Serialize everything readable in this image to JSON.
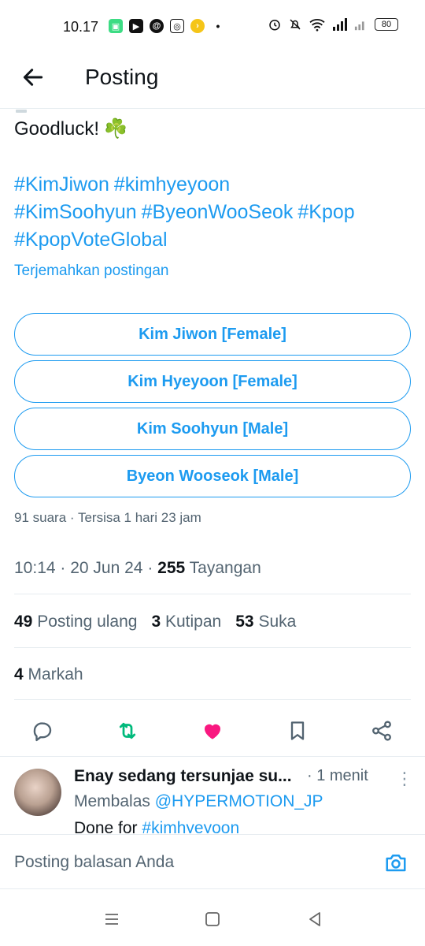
{
  "status_bar": {
    "time": "10.17",
    "battery": "80"
  },
  "header": {
    "title": "Posting"
  },
  "post": {
    "body": "Goodluck!",
    "body_emoji": "☘️",
    "hashtags": [
      "#KimJiwon",
      "#kimhyeyoon",
      "#KimSoohyun",
      "#ByeonWooSeok",
      "#Kpop",
      "#KpopVoteGlobal"
    ],
    "translate_link": "Terjemahkan postingan",
    "poll": {
      "options": [
        "Kim Jiwon [Female]",
        "Kim Hyeyoon [Female]",
        "Kim Soohyun [Male]",
        "Byeon Wooseok [Male]"
      ],
      "meta": "91 suara · Tersisa 1 hari 23 jam"
    },
    "time": "10:14",
    "date": "20 Jun 24",
    "views_count": "255",
    "views_label": "Tayangan",
    "reposts_count": "49",
    "reposts_label": "Posting ulang",
    "quotes_count": "3",
    "quotes_label": "Kutipan",
    "likes_count": "53",
    "likes_label": "Suka",
    "bookmarks_count": "4",
    "bookmarks_label": "Markah"
  },
  "colors": {
    "accent": "#1d9bf0",
    "repost": "#00ba7c",
    "like": "#f91880",
    "muted": "#536471"
  },
  "reply": {
    "name": "Enay sedang tersunjae su...",
    "time": "· 1 menit",
    "replying_prefix": "Membalas",
    "replying_to": "@HYPERMOTION_JP",
    "text_prefix": "Done for",
    "text_tag": "#kimhyeyoon"
  },
  "composer": {
    "placeholder": "Posting balasan Anda"
  }
}
